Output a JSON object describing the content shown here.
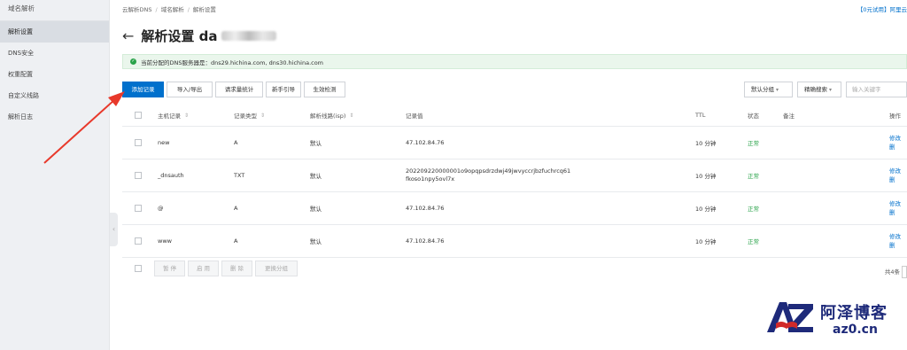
{
  "sidebar": {
    "title": "域名解析",
    "items": [
      {
        "label": "解析设置",
        "active": true
      },
      {
        "label": "DNS安全",
        "active": false
      },
      {
        "label": "权重配置",
        "active": false
      },
      {
        "label": "自定义线路",
        "active": false
      },
      {
        "label": "解析日志",
        "active": false
      }
    ]
  },
  "breadcrumb": {
    "items": [
      "云解析DNS",
      "域名解析",
      "解析设置"
    ],
    "separator": "/"
  },
  "top_right": "【0元试用】阿里云",
  "page": {
    "title": "解析设置 da"
  },
  "notice": {
    "text": "当前分配的DNS服务器是：dns29.hichina.com, dns30.hichina.com"
  },
  "toolbar": {
    "add_record": "添加记录",
    "import_export": "导入/导出",
    "request_stats": "请求量统计",
    "new_guide": "新手引导",
    "effect_check": "生效检测",
    "group_select": "默认分组",
    "search_mode": "精确搜索",
    "search_placeholder": "输入关键字"
  },
  "table": {
    "headers": {
      "host": "主机记录",
      "type": "记录类型",
      "line": "解析线路(isp)",
      "value": "记录值",
      "ttl": "TTL",
      "status": "状态",
      "remark": "备注",
      "ops": "操作"
    },
    "rows": [
      {
        "host": "new",
        "type": "A",
        "line": "默认",
        "value": [
          "47.102.84.76"
        ],
        "ttl": "10 分钟",
        "status": "正常",
        "op1": "修改",
        "op2": "删"
      },
      {
        "host": "_dnsauth",
        "type": "TXT",
        "line": "默认",
        "value": [
          "202209220000001o9opqpsdrzdwj49jwvyccrjbzfuchrcq61",
          "fkoso1npy5ovl7x"
        ],
        "ttl": "10 分钟",
        "status": "正常",
        "op1": "修改",
        "op2": "删"
      },
      {
        "host": "@",
        "type": "A",
        "line": "默认",
        "value": [
          "47.102.84.76"
        ],
        "ttl": "10 分钟",
        "status": "正常",
        "op1": "修改",
        "op2": "删"
      },
      {
        "host": "www",
        "type": "A",
        "line": "默认",
        "value": [
          "47.102.84.76"
        ],
        "ttl": "10 分钟",
        "status": "正常",
        "op1": "修改",
        "op2": "删"
      }
    ]
  },
  "footer": {
    "pause": "暂 停",
    "enable": "启 用",
    "delete": "删 除",
    "change_group": "更换分组",
    "total": "共4条"
  },
  "watermark": {
    "cn": "阿泽博客",
    "en": "az0.cn",
    "logo_text": "AZ"
  },
  "colors": {
    "primary": "#0070cc",
    "status_ok": "#2aa34a",
    "annotation_arrow": "#e8392b",
    "watermark": "#1e2a7a"
  }
}
